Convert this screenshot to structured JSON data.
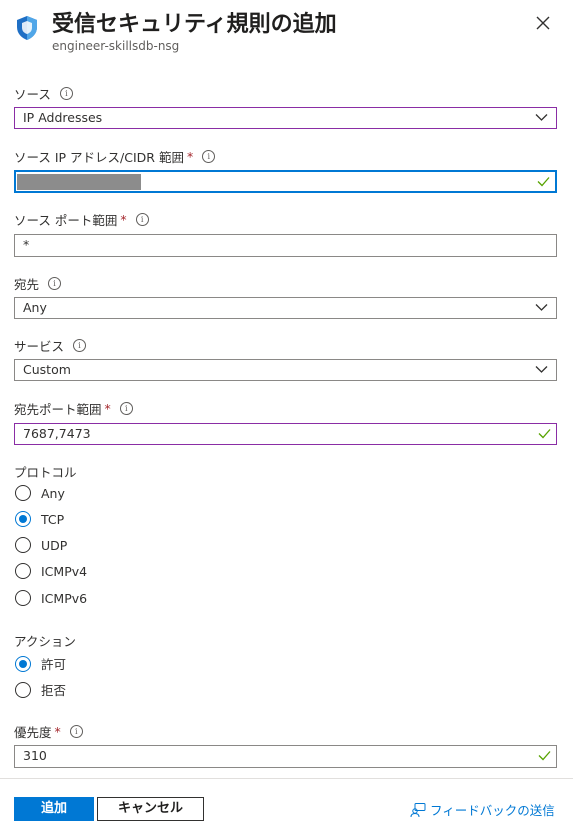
{
  "header": {
    "title": "受信セキュリティ規則の追加",
    "subtitle": "engineer-skillsdb-nsg"
  },
  "form": {
    "source": {
      "label": "ソース",
      "value": "IP Addresses"
    },
    "source_ip": {
      "label": "ソース IP アドレス/CIDR 範囲",
      "value": ""
    },
    "source_port": {
      "label": "ソース ポート範囲",
      "value": "*"
    },
    "destination": {
      "label": "宛先",
      "value": "Any"
    },
    "service": {
      "label": "サービス",
      "value": "Custom"
    },
    "dest_port": {
      "label": "宛先ポート範囲",
      "value": "7687,7473"
    },
    "protocol": {
      "label": "プロトコル",
      "options": [
        "Any",
        "TCP",
        "UDP",
        "ICMPv4",
        "ICMPv6"
      ],
      "selected": "TCP"
    },
    "action": {
      "label": "アクション",
      "options": [
        "許可",
        "拒否"
      ],
      "selected": "許可"
    },
    "priority": {
      "label": "優先度",
      "value": "310"
    }
  },
  "footer": {
    "add_label": "追加",
    "cancel_label": "キャンセル",
    "feedback_label": "フィードバックの送信"
  },
  "colors": {
    "accent": "#0078d4",
    "required": "#a4262c",
    "valid_border": "#8a2da5",
    "check": "#57a300"
  }
}
